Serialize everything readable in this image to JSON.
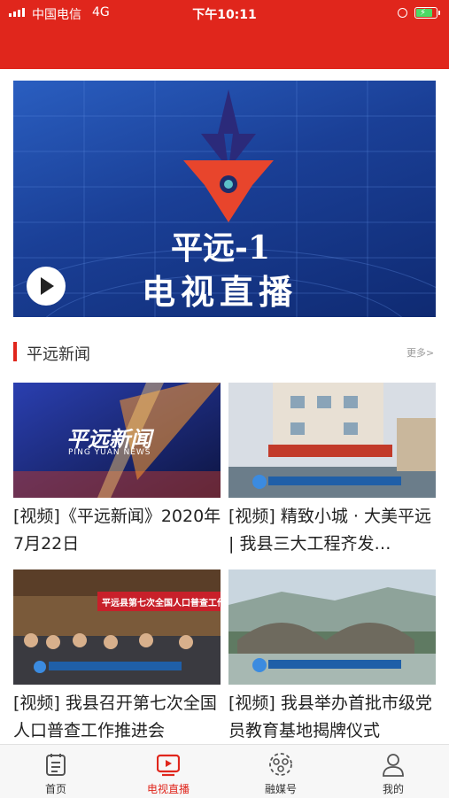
{
  "status_bar": {
    "carrier": "中国电信",
    "network": "4G",
    "time": "下午10:11"
  },
  "banner": {
    "line1": "平远-1",
    "line2": "电视直播",
    "icon": "play-icon"
  },
  "section": {
    "title": "平远新闻",
    "more": "更多>"
  },
  "news": [
    {
      "title": "[视频]《平远新闻》2020年7月22日",
      "thumb_caption": "平远新闻",
      "thumb_sub": "PING YUAN NEWS"
    },
    {
      "title": "[视频] 精致小城 · 大美平远 | 我县三大工程齐发…"
    },
    {
      "title": "[视频] 我县召开第七次全国人口普查工作推进会",
      "thumb_caption": "平远县第七次全国人口普查工作推进会"
    },
    {
      "title": "[视频] 我县举办首批市级党员教育基地揭牌仪式"
    }
  ],
  "tabs": [
    {
      "label": "首页",
      "icon": "home-list-icon"
    },
    {
      "label": "电视直播",
      "icon": "tv-live-icon"
    },
    {
      "label": "融媒号",
      "icon": "media-account-icon"
    },
    {
      "label": "我的",
      "icon": "profile-icon"
    }
  ],
  "colors": {
    "accent": "#e0261c",
    "tab_inactive": "#555555"
  }
}
